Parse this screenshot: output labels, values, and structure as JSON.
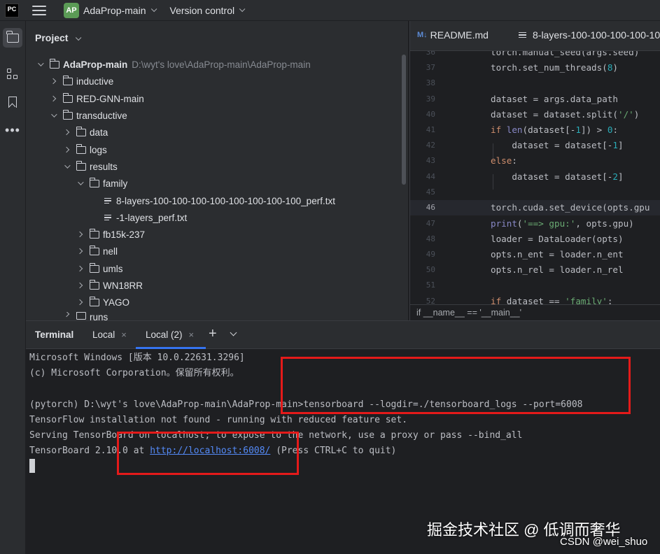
{
  "titlebar": {
    "app_logo": "PC",
    "project_badge": "AP",
    "project_name": "AdaProp-main",
    "version_control": "Version control"
  },
  "project_panel": {
    "title": "Project",
    "tree": [
      {
        "label": "AdaProp-main",
        "hint": "D:\\wyt's love\\AdaProp-main\\AdaProp-main",
        "type": "folder",
        "expanded": true
      },
      {
        "label": "inductive",
        "type": "folder",
        "expanded": false
      },
      {
        "label": "RED-GNN-main",
        "type": "folder",
        "expanded": false
      },
      {
        "label": "transductive",
        "type": "folder",
        "expanded": true
      },
      {
        "label": "data",
        "type": "folder",
        "expanded": false
      },
      {
        "label": "logs",
        "type": "folder",
        "expanded": false
      },
      {
        "label": "results",
        "type": "folder",
        "expanded": true
      },
      {
        "label": "family",
        "type": "folder",
        "expanded": true
      },
      {
        "label": "8-layers-100-100-100-100-100-100-100-100_perf.txt",
        "type": "file"
      },
      {
        "label": "-1-layers_perf.txt",
        "type": "file"
      },
      {
        "label": "fb15k-237",
        "type": "folder",
        "expanded": false
      },
      {
        "label": "nell",
        "type": "folder",
        "expanded": false
      },
      {
        "label": "umls",
        "type": "folder",
        "expanded": false
      },
      {
        "label": "WN18RR",
        "type": "folder",
        "expanded": false
      },
      {
        "label": "YAGO",
        "type": "folder",
        "expanded": false
      },
      {
        "label": "runs",
        "type": "folder",
        "expanded": false
      }
    ]
  },
  "editor": {
    "tabs": [
      {
        "label": "README.md",
        "icon": "M↓"
      },
      {
        "label": "8-layers-100-100-100-100-10"
      }
    ],
    "lines": [
      {
        "n": "36",
        "code": "torch.manual_seed(args.seed)"
      },
      {
        "n": "37",
        "code": "torch.set_num_threads(8)"
      },
      {
        "n": "38",
        "code": ""
      },
      {
        "n": "39",
        "code": "dataset = args.data_path"
      },
      {
        "n": "40",
        "code": "dataset = dataset.split('/')"
      },
      {
        "n": "41",
        "code": "if len(dataset[-1]) > 0:"
      },
      {
        "n": "42",
        "code": "    dataset = dataset[-1]"
      },
      {
        "n": "43",
        "code": "else:"
      },
      {
        "n": "44",
        "code": "    dataset = dataset[-2]"
      },
      {
        "n": "45",
        "code": ""
      },
      {
        "n": "46",
        "code": "torch.cuda.set_device(opts.gpu"
      },
      {
        "n": "47",
        "code": "print('==> gpu:', opts.gpu)"
      },
      {
        "n": "48",
        "code": "loader = DataLoader(opts)"
      },
      {
        "n": "49",
        "code": "opts.n_ent = loader.n_ent"
      },
      {
        "n": "50",
        "code": "opts.n_rel = loader.n_rel"
      },
      {
        "n": "51",
        "code": ""
      },
      {
        "n": "52",
        "code": "if dataset == 'family':"
      }
    ],
    "breadcrumb": "if __name__ == '__main__'"
  },
  "terminal": {
    "header": "Terminal",
    "tabs": [
      {
        "label": "Local",
        "close": "×"
      },
      {
        "label": "Local (2)",
        "close": "×"
      }
    ],
    "new_tab": "+",
    "lines": [
      "Microsoft Windows [版本 10.0.22631.3296]",
      "(c) Microsoft Corporation。保留所有权利。",
      "",
      "(pytorch) D:\\wyt's love\\AdaProp-main\\AdaProp-main>tensorboard --logdir=./tensorboard_logs --port=6008",
      "TensorFlow installation not found - running with reduced feature set.",
      "Serving TensorBoard on localhost; to expose to the network, use a proxy or pass --bind_all"
    ],
    "last_line": {
      "prefix": "TensorBoard 2.10.0 at ",
      "link": "http://localhost:6008/",
      "suffix": " (Press CTRL+C to quit)"
    }
  },
  "watermark": {
    "main": "掘金技术社区 @ 低调而奢华",
    "sub": "CSDN @wei_shuo"
  },
  "colors": {
    "highlight_box": "#e41a1a",
    "link": "#548af7",
    "active_tab_underline": "#3574f0",
    "badge": "#5b9b56"
  }
}
